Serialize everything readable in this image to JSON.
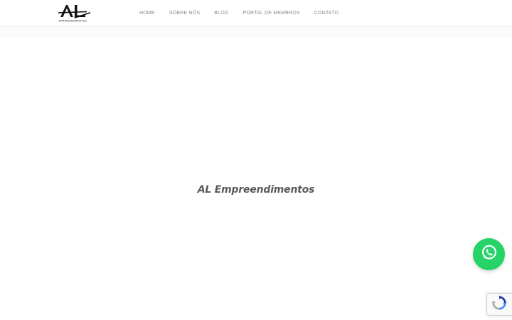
{
  "header": {
    "logo": {
      "mark": "AL",
      "subtext": "EMPREENDIMENTOS"
    },
    "nav": {
      "items": [
        {
          "label": "HOME"
        },
        {
          "label": "SOBRE NÓS"
        },
        {
          "label": "BLOG"
        },
        {
          "label": "PORTAL DE MEMBROS"
        },
        {
          "label": "CONTATO"
        }
      ]
    }
  },
  "main": {
    "title": "AL Empreendimentos"
  },
  "widgets": {
    "whatsapp": {
      "icon": "whatsapp-icon",
      "color": "#25d366"
    },
    "recaptcha": {
      "icon": "recaptcha-icon"
    }
  },
  "colors": {
    "nav_text": "#8c8c8c",
    "title_text": "#5a5a5a",
    "whatsapp_green": "#25d366"
  }
}
